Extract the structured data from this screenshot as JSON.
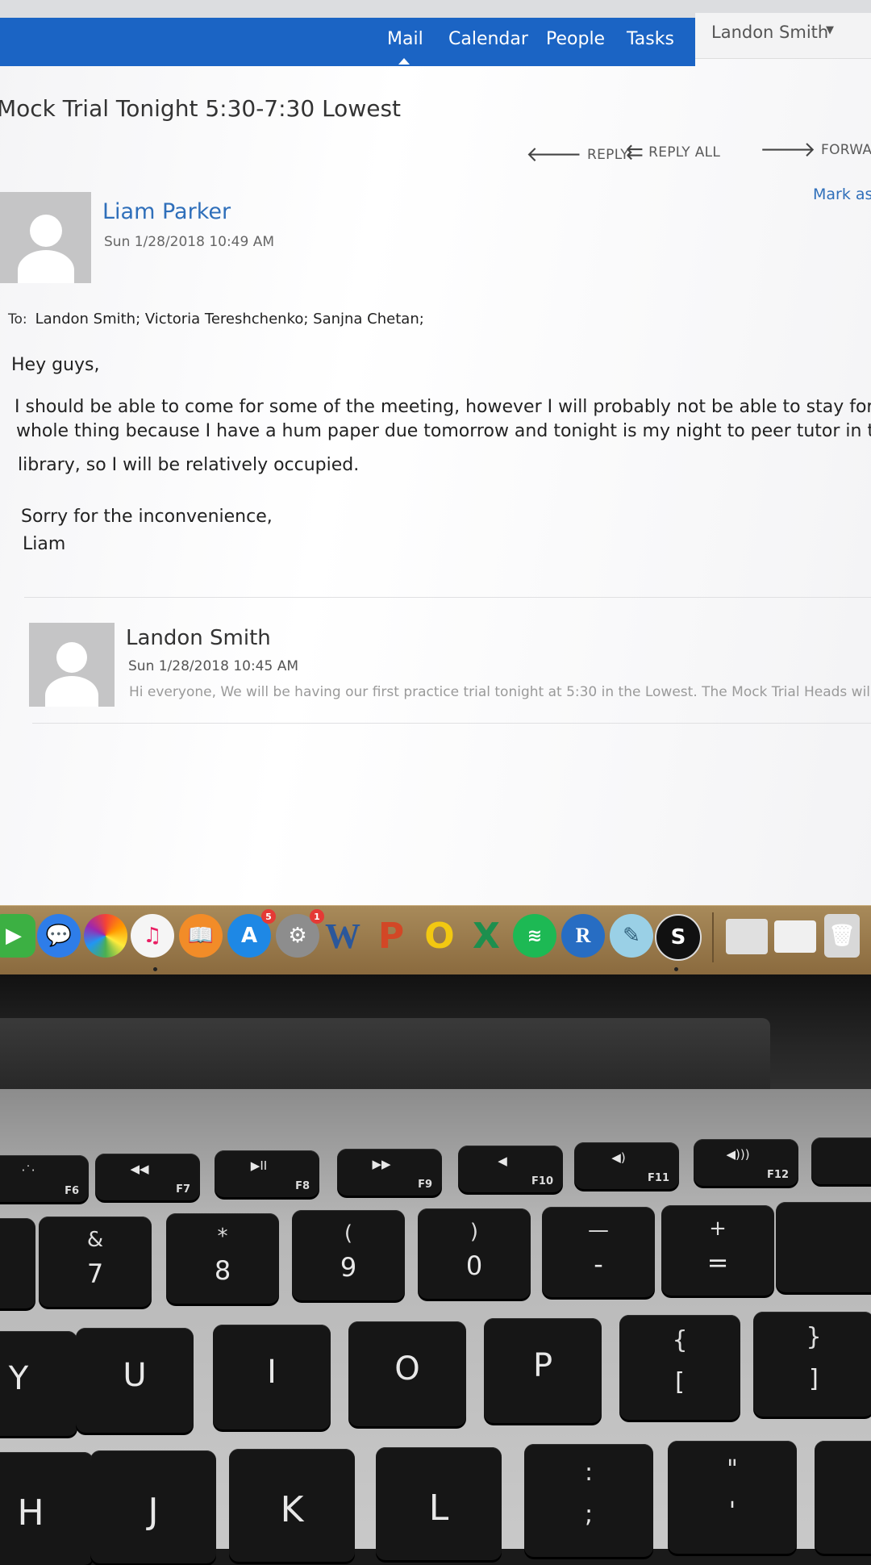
{
  "nav": {
    "tabs": [
      "Mail",
      "Calendar",
      "People",
      "Tasks"
    ],
    "user": "Landon Smith"
  },
  "email": {
    "subject": "Mock Trial Tonight 5:30-7:30 Lowest",
    "actions": {
      "reply": "REPLY",
      "reply_all": "REPLY ALL",
      "forward": "FORWARD"
    },
    "mark_as": "Mark as",
    "sender": "Liam Parker",
    "datetime": "Sun 1/28/2018 10:49 AM",
    "to_label": "To:",
    "recipients": "Landon Smith;  Victoria Tereshchenko;  Sanjna Chetan;",
    "body": [
      "Hey guys,",
      "I should be able to come for some of the meeting, however I will probably not be able to stay for the",
      "whole thing because I have a hum paper due tomorrow and tonight is my night to peer tutor in the",
      "library, so I will be relatively occupied.",
      "Sorry for the inconvenience,",
      "Liam"
    ]
  },
  "previous_message": {
    "sender": "Landon Smith",
    "datetime": "Sun 1/28/2018 10:45 AM",
    "preview": "Hi everyone, We will be having our first practice trial tonight at 5:30 in the Lowest. The Mock Trial Heads will be"
  },
  "dock": {
    "badges": {
      "app_store": "5",
      "system_preferences": "1"
    },
    "letters": {
      "word": "W",
      "powerpoint": "P",
      "outlook": "O",
      "excel": "X",
      "r": "R",
      "scrivener": "S"
    }
  },
  "keyboard": {
    "fn_row": [
      {
        "icon": "·˙·",
        "label": "F6"
      },
      {
        "icon": "◀◀",
        "label": "F7"
      },
      {
        "icon": "▶II",
        "label": "F8"
      },
      {
        "icon": "▶▶",
        "label": "F9"
      },
      {
        "icon": "◀",
        "label": "F10"
      },
      {
        "icon": "◀)",
        "label": "F11"
      },
      {
        "icon": "◀)))",
        "label": "F12"
      }
    ],
    "number_row": [
      {
        "top": "&",
        "bottom": "7"
      },
      {
        "top": "*",
        "bottom": "8"
      },
      {
        "top": "(",
        "bottom": "9"
      },
      {
        "top": ")",
        "bottom": "0"
      },
      {
        "top": "—",
        "bottom": "-"
      },
      {
        "top": "+",
        "bottom": "="
      }
    ],
    "letter_row": [
      "Y",
      "U",
      "I",
      "O",
      "P"
    ],
    "bracket_keys": [
      {
        "top": "{",
        "bottom": "["
      },
      {
        "top": "}",
        "bottom": "]"
      }
    ],
    "home_row": [
      "H",
      "J",
      "K",
      "L"
    ],
    "punct_keys": [
      {
        "top": ":",
        "bottom": ";"
      },
      {
        "top": "\"",
        "bottom": "'"
      }
    ]
  }
}
